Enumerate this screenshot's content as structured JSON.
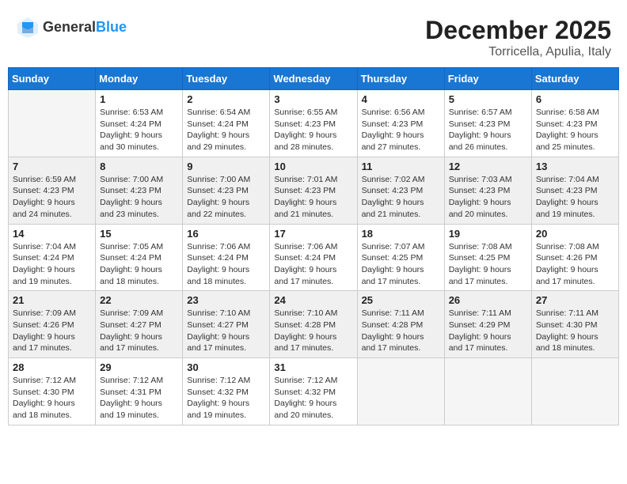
{
  "header": {
    "logo_general": "General",
    "logo_blue": "Blue",
    "month_year": "December 2025",
    "location": "Torricella, Apulia, Italy"
  },
  "days_of_week": [
    "Sunday",
    "Monday",
    "Tuesday",
    "Wednesday",
    "Thursday",
    "Friday",
    "Saturday"
  ],
  "weeks": [
    [
      {
        "day": "",
        "sunrise": "",
        "sunset": "",
        "daylight": ""
      },
      {
        "day": "1",
        "sunrise": "Sunrise: 6:53 AM",
        "sunset": "Sunset: 4:24 PM",
        "daylight": "Daylight: 9 hours and 30 minutes."
      },
      {
        "day": "2",
        "sunrise": "Sunrise: 6:54 AM",
        "sunset": "Sunset: 4:24 PM",
        "daylight": "Daylight: 9 hours and 29 minutes."
      },
      {
        "day": "3",
        "sunrise": "Sunrise: 6:55 AM",
        "sunset": "Sunset: 4:23 PM",
        "daylight": "Daylight: 9 hours and 28 minutes."
      },
      {
        "day": "4",
        "sunrise": "Sunrise: 6:56 AM",
        "sunset": "Sunset: 4:23 PM",
        "daylight": "Daylight: 9 hours and 27 minutes."
      },
      {
        "day": "5",
        "sunrise": "Sunrise: 6:57 AM",
        "sunset": "Sunset: 4:23 PM",
        "daylight": "Daylight: 9 hours and 26 minutes."
      },
      {
        "day": "6",
        "sunrise": "Sunrise: 6:58 AM",
        "sunset": "Sunset: 4:23 PM",
        "daylight": "Daylight: 9 hours and 25 minutes."
      }
    ],
    [
      {
        "day": "7",
        "sunrise": "Sunrise: 6:59 AM",
        "sunset": "Sunset: 4:23 PM",
        "daylight": "Daylight: 9 hours and 24 minutes."
      },
      {
        "day": "8",
        "sunrise": "Sunrise: 7:00 AM",
        "sunset": "Sunset: 4:23 PM",
        "daylight": "Daylight: 9 hours and 23 minutes."
      },
      {
        "day": "9",
        "sunrise": "Sunrise: 7:00 AM",
        "sunset": "Sunset: 4:23 PM",
        "daylight": "Daylight: 9 hours and 22 minutes."
      },
      {
        "day": "10",
        "sunrise": "Sunrise: 7:01 AM",
        "sunset": "Sunset: 4:23 PM",
        "daylight": "Daylight: 9 hours and 21 minutes."
      },
      {
        "day": "11",
        "sunrise": "Sunrise: 7:02 AM",
        "sunset": "Sunset: 4:23 PM",
        "daylight": "Daylight: 9 hours and 21 minutes."
      },
      {
        "day": "12",
        "sunrise": "Sunrise: 7:03 AM",
        "sunset": "Sunset: 4:23 PM",
        "daylight": "Daylight: 9 hours and 20 minutes."
      },
      {
        "day": "13",
        "sunrise": "Sunrise: 7:04 AM",
        "sunset": "Sunset: 4:23 PM",
        "daylight": "Daylight: 9 hours and 19 minutes."
      }
    ],
    [
      {
        "day": "14",
        "sunrise": "Sunrise: 7:04 AM",
        "sunset": "Sunset: 4:24 PM",
        "daylight": "Daylight: 9 hours and 19 minutes."
      },
      {
        "day": "15",
        "sunrise": "Sunrise: 7:05 AM",
        "sunset": "Sunset: 4:24 PM",
        "daylight": "Daylight: 9 hours and 18 minutes."
      },
      {
        "day": "16",
        "sunrise": "Sunrise: 7:06 AM",
        "sunset": "Sunset: 4:24 PM",
        "daylight": "Daylight: 9 hours and 18 minutes."
      },
      {
        "day": "17",
        "sunrise": "Sunrise: 7:06 AM",
        "sunset": "Sunset: 4:24 PM",
        "daylight": "Daylight: 9 hours and 17 minutes."
      },
      {
        "day": "18",
        "sunrise": "Sunrise: 7:07 AM",
        "sunset": "Sunset: 4:25 PM",
        "daylight": "Daylight: 9 hours and 17 minutes."
      },
      {
        "day": "19",
        "sunrise": "Sunrise: 7:08 AM",
        "sunset": "Sunset: 4:25 PM",
        "daylight": "Daylight: 9 hours and 17 minutes."
      },
      {
        "day": "20",
        "sunrise": "Sunrise: 7:08 AM",
        "sunset": "Sunset: 4:26 PM",
        "daylight": "Daylight: 9 hours and 17 minutes."
      }
    ],
    [
      {
        "day": "21",
        "sunrise": "Sunrise: 7:09 AM",
        "sunset": "Sunset: 4:26 PM",
        "daylight": "Daylight: 9 hours and 17 minutes."
      },
      {
        "day": "22",
        "sunrise": "Sunrise: 7:09 AM",
        "sunset": "Sunset: 4:27 PM",
        "daylight": "Daylight: 9 hours and 17 minutes."
      },
      {
        "day": "23",
        "sunrise": "Sunrise: 7:10 AM",
        "sunset": "Sunset: 4:27 PM",
        "daylight": "Daylight: 9 hours and 17 minutes."
      },
      {
        "day": "24",
        "sunrise": "Sunrise: 7:10 AM",
        "sunset": "Sunset: 4:28 PM",
        "daylight": "Daylight: 9 hours and 17 minutes."
      },
      {
        "day": "25",
        "sunrise": "Sunrise: 7:11 AM",
        "sunset": "Sunset: 4:28 PM",
        "daylight": "Daylight: 9 hours and 17 minutes."
      },
      {
        "day": "26",
        "sunrise": "Sunrise: 7:11 AM",
        "sunset": "Sunset: 4:29 PM",
        "daylight": "Daylight: 9 hours and 17 minutes."
      },
      {
        "day": "27",
        "sunrise": "Sunrise: 7:11 AM",
        "sunset": "Sunset: 4:30 PM",
        "daylight": "Daylight: 9 hours and 18 minutes."
      }
    ],
    [
      {
        "day": "28",
        "sunrise": "Sunrise: 7:12 AM",
        "sunset": "Sunset: 4:30 PM",
        "daylight": "Daylight: 9 hours and 18 minutes."
      },
      {
        "day": "29",
        "sunrise": "Sunrise: 7:12 AM",
        "sunset": "Sunset: 4:31 PM",
        "daylight": "Daylight: 9 hours and 19 minutes."
      },
      {
        "day": "30",
        "sunrise": "Sunrise: 7:12 AM",
        "sunset": "Sunset: 4:32 PM",
        "daylight": "Daylight: 9 hours and 19 minutes."
      },
      {
        "day": "31",
        "sunrise": "Sunrise: 7:12 AM",
        "sunset": "Sunset: 4:32 PM",
        "daylight": "Daylight: 9 hours and 20 minutes."
      },
      {
        "day": "",
        "sunrise": "",
        "sunset": "",
        "daylight": ""
      },
      {
        "day": "",
        "sunrise": "",
        "sunset": "",
        "daylight": ""
      },
      {
        "day": "",
        "sunrise": "",
        "sunset": "",
        "daylight": ""
      }
    ]
  ]
}
